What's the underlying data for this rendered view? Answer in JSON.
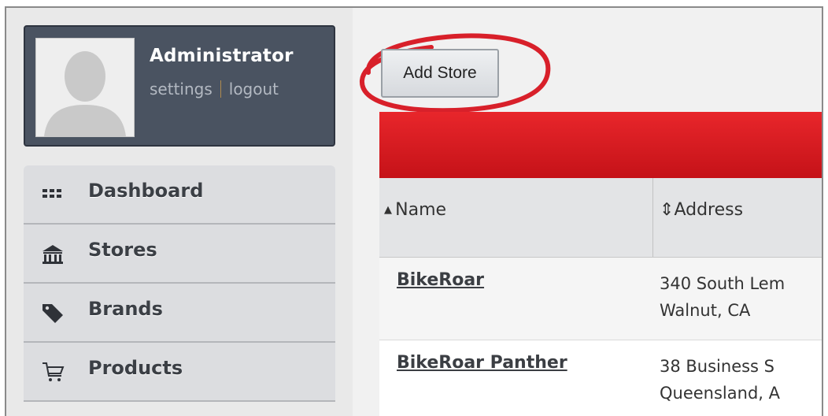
{
  "profile": {
    "name": "Administrator",
    "settings_link": "settings",
    "logout_link": "logout"
  },
  "nav": {
    "items": [
      {
        "label": "Dashboard",
        "icon": "dashboard-grid-icon"
      },
      {
        "label": "Stores",
        "icon": "store-icon"
      },
      {
        "label": "Brands",
        "icon": "tag-icon"
      },
      {
        "label": "Products",
        "icon": "cart-icon"
      }
    ]
  },
  "toolbar": {
    "add_store_label": "Add Store"
  },
  "table": {
    "columns": [
      {
        "label": "Name",
        "sort_icon": "sort-asc-icon"
      },
      {
        "label": "Address",
        "sort_icon": "sort-both-icon"
      }
    ],
    "rows": [
      {
        "name": "BikeRoar",
        "address_line1": "340 South Lem",
        "address_line2": "Walnut, CA"
      },
      {
        "name": "BikeRoar Panther",
        "address_line1": "38 Business S",
        "address_line2": "Queensland, A"
      }
    ]
  },
  "colors": {
    "sidebar_profile_bg": "#4a5361",
    "table_header_red": "#d81a20",
    "annotation_circle": "#d8202a"
  }
}
